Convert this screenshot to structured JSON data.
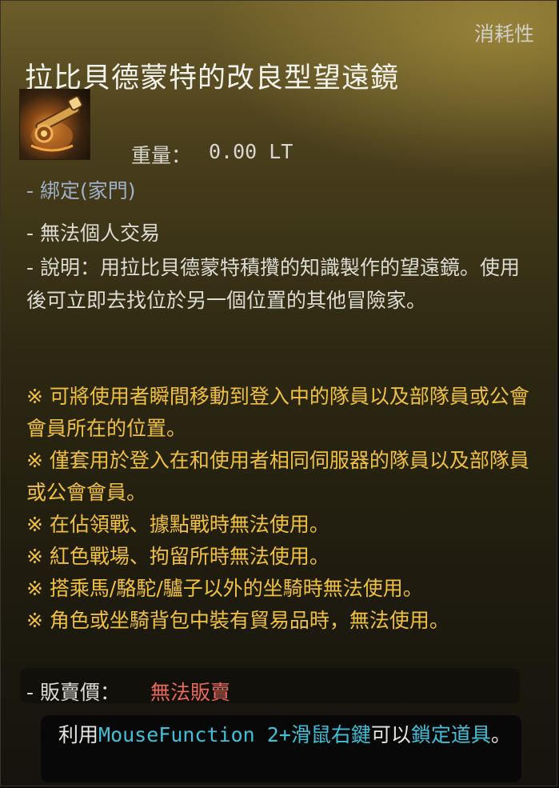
{
  "tooltip": {
    "category": "消耗性",
    "title": "拉比貝德蒙特的改良型望遠鏡",
    "icon": "telescope-item-icon",
    "weight_label": "重量：",
    "weight_value": "0.00 LT",
    "bind": "- 綁定(家門)",
    "trade": "- 無法個人交易",
    "description": "- 說明：用拉比貝德蒙特積攢的知識製作的望遠鏡。使用後可立即去找位於另一個位置的其他冒險家。",
    "notes": [
      "※ 可將使用者瞬間移動到登入中的隊員以及部隊員或公會會員所在的位置。",
      "※ 僅套用於登入在和使用者相同伺服器的隊員以及部隊員或公會會員。",
      "※ 在佔領戰、據點戰時無法使用。",
      "※ 紅色戰場、拘留所時無法使用。",
      "※ 搭乘馬/駱駝/驢子以外的坐騎時無法使用。",
      "※ 角色或坐騎背包中裝有貿易品時，無法使用。"
    ],
    "sell_label": "- 販賣價：",
    "sell_value": "無法販賣",
    "hint": {
      "prefix": "利用",
      "keybind": "MouseFunction 2+滑鼠右鍵",
      "middle": "可以",
      "action": "鎖定道具",
      "suffix": "。"
    },
    "colors": {
      "note_color": "#f0c040",
      "sell_value_color": "#e86a5a",
      "highlight_color": "#40c0d8",
      "bind_color": "#9fb0c8"
    }
  }
}
